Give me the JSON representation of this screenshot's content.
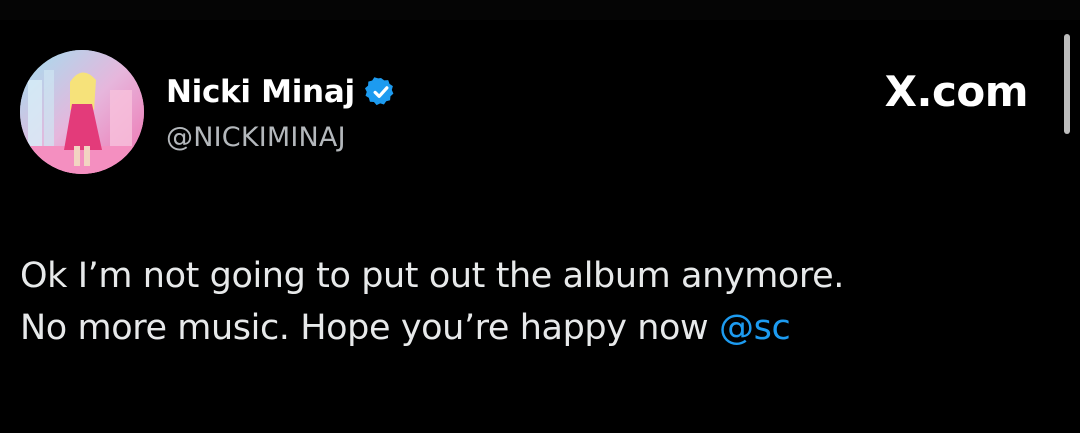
{
  "post": {
    "author": {
      "display_name": "Nicki Minaj",
      "handle": "@NICKIMINAJ",
      "verified": true
    },
    "source": "X.com",
    "text_lines": [
      "Ok I’m not going to put out the album anymore.",
      "No more music. Hope you’re happy now "
    ],
    "mention": "@sc"
  },
  "colors": {
    "background": "#000000",
    "text": "#e7e9ea",
    "handle": "#b4b8bc",
    "verified_badge": "#1d9bf0",
    "mention": "#1d9bf0"
  },
  "icons": {
    "verified": "verified-badge-icon",
    "avatar": "profile-avatar"
  }
}
